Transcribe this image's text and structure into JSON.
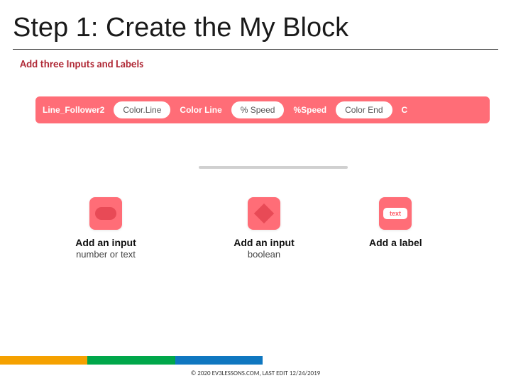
{
  "title": "Step 1: Create the My Block",
  "subtitle": "Add three Inputs and Labels",
  "block": {
    "name": "Line_Follower2",
    "items": [
      {
        "kind": "pill",
        "text": "Color.Line"
      },
      {
        "kind": "slot",
        "text": "Color Line"
      },
      {
        "kind": "pill",
        "text": "% Speed"
      },
      {
        "kind": "slot",
        "text": "%Speed"
      },
      {
        "kind": "pill",
        "text": "Color End"
      },
      {
        "kind": "slot",
        "text": "C"
      }
    ]
  },
  "buttons": [
    {
      "icon": "oval",
      "title": "Add an input",
      "sub": "number or text"
    },
    {
      "icon": "diamond",
      "title": "Add an input",
      "sub": "boolean"
    },
    {
      "icon": "text",
      "icon_label": "text",
      "title": "Add a label",
      "sub": ""
    }
  ],
  "footer": {
    "colors": [
      "#f5a100",
      "#00a74a",
      "#0f77c0"
    ],
    "text": "© 2020 EV3LESSONS.COM, LAST EDIT 12/24/2019"
  }
}
